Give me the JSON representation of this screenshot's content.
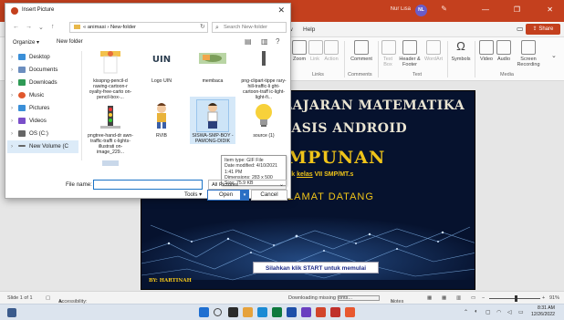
{
  "powerpoint": {
    "user_name": "Nur Lisa",
    "user_initials": "NL",
    "tabs": [
      "w",
      "Help"
    ],
    "share_label": "Share",
    "ribbon_buttons": {
      "zoom": "Zoom",
      "link": "Link",
      "action": "Action",
      "comment": "Comment",
      "text_box": "Text Box",
      "header_footer": "Header & Footer",
      "wordart": "WordArt",
      "symbols": "Symbols",
      "video": "Video",
      "audio": "Audio",
      "screen_recording": "Screen Recording"
    },
    "ribbon_groups": {
      "links": "Links",
      "comments": "Comments",
      "text": "Text",
      "media": "Media"
    }
  },
  "slide": {
    "line1": "ELAJARAN MATEMATIKA",
    "line2": "BASIS ANDROID",
    "line3": "MPUNAN",
    "line4_prefix": "uk ",
    "line4_kelas": "kelas",
    "line4_suffix": " VII SMP/MT.s",
    "line5": "LAMAT DATANG",
    "start_prompt": "Silahkan klik START untuk memulai",
    "author": "BY: HARTINAH"
  },
  "dialog": {
    "title": "Insert Picture",
    "address": "« animasi › New-folder",
    "search_placeholder": "Search New-folder",
    "organize": "Organize ▾",
    "new_folder": "New folder",
    "nav_items": [
      {
        "label": "Desktop",
        "color": "#3a8fd8"
      },
      {
        "label": "Documents",
        "color": "#6c8ebf"
      },
      {
        "label": "Downloads",
        "color": "#2e9a55"
      },
      {
        "label": "Music",
        "color": "#e0572c"
      },
      {
        "label": "Pictures",
        "color": "#3a8fd8"
      },
      {
        "label": "Videos",
        "color": "#7a4fc9"
      },
      {
        "label": "OS (C:)",
        "color": "#666666"
      },
      {
        "label": "New Volume (C",
        "color": "#666666"
      }
    ],
    "files": [
      {
        "label": "kisspng-pencil-d rawing-cartoon-r oyalty-free-carto on-pencil-box-..."
      },
      {
        "label": "Logo UIN"
      },
      {
        "label": "membaca"
      },
      {
        "label": "png-clipart-tippe rary-hill-traffic-li ght-cartoon-traff ic-light-light-fi..."
      },
      {
        "label": "pngtree-hand-dr awn-traffic-traffi c-lights-illustrati on-image_229..."
      },
      {
        "label": "RVIB"
      },
      {
        "label": "SISWA-SMP-BOY -PAMONG-DIDIK"
      },
      {
        "label": "source (1)"
      }
    ],
    "tooltip": {
      "type": "Item type: GIF File",
      "modified": "Date modified: 4/10/2021 1:41 PM",
      "dimensions": "Dimensions: 283 x 500",
      "size": "Size: 75.9 KB"
    },
    "file_name_label": "File name:",
    "file_name_value": "",
    "file_type": "All Pictures",
    "tools_label": "Tools ▾",
    "insert_label": "Open",
    "cancel_label": "Cancel"
  },
  "status": {
    "slide_info": "Slide 1 of 1",
    "accessibility": "Accessibility: Investigate",
    "downloading": "Downloading missing fonts...",
    "notes": "Notes",
    "zoom": "91%"
  },
  "taskbar": {
    "time": "8:31 AM",
    "date": "12/26/2022"
  }
}
